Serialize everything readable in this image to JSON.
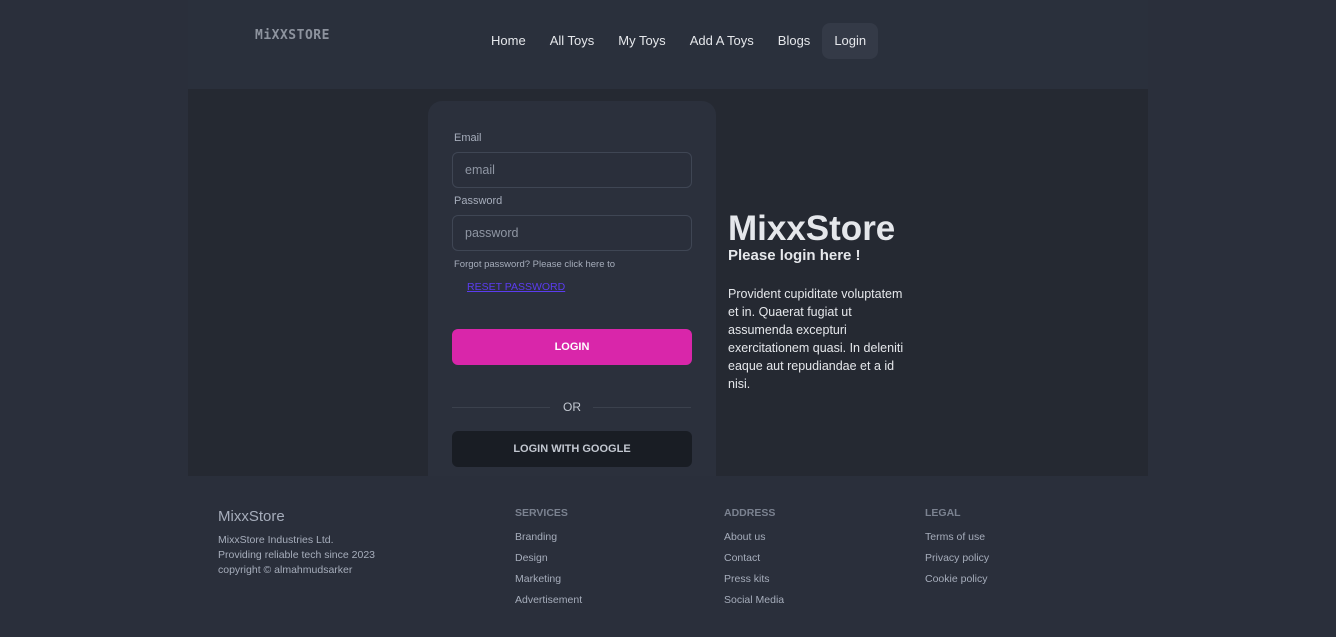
{
  "nav": {
    "logo": "MiXXSTORE",
    "items": [
      {
        "label": "Home"
      },
      {
        "label": "All Toys"
      },
      {
        "label": "My Toys"
      },
      {
        "label": "Add A Toys"
      },
      {
        "label": "Blogs"
      },
      {
        "label": "Login"
      }
    ]
  },
  "login_form": {
    "email_label": "Email",
    "email_placeholder": "email",
    "email_value": "",
    "password_label": "Password",
    "password_placeholder": "password",
    "password_value": "",
    "forgot_text": "Forgot password? Please click here to",
    "reset_link": "RESET PASSWORD",
    "login_button": "LOGIN",
    "or_text": "OR",
    "google_button": "LOGIN WITH GOOGLE"
  },
  "hero": {
    "title": "MixxStore",
    "subtitle": "Please login here !",
    "description": "Provident cupiditate voluptatem et in. Quaerat fugiat ut assumenda excepturi exercitationem quasi. In deleniti eaque aut repudiandae et a id nisi."
  },
  "footer": {
    "brand": "MixxStore",
    "brand_lines": [
      "MixxStore Industries Ltd.",
      "Providing reliable tech since 2023",
      "copyright © almahmudsarker"
    ],
    "columns": [
      {
        "title": "SERVICES",
        "links": [
          "Branding",
          "Design",
          "Marketing",
          "Advertisement"
        ]
      },
      {
        "title": "ADDRESS",
        "links": [
          "About us",
          "Contact",
          "Press kits",
          "Social Media"
        ]
      },
      {
        "title": "LEGAL",
        "links": [
          "Terms of use",
          "Privacy policy",
          "Cookie policy"
        ]
      }
    ]
  },
  "colors": {
    "accent_pink": "#d926aa",
    "link_purple": "#5b3cf0",
    "background": "#2a2f3b"
  }
}
